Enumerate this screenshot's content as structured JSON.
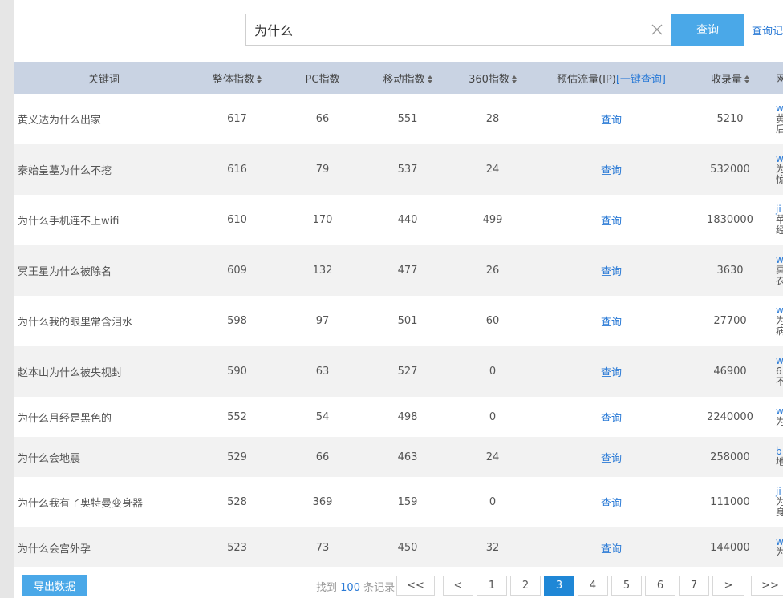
{
  "search": {
    "value": "为什么",
    "button": "查询",
    "history": "查询记"
  },
  "columns": {
    "keyword": "关键词",
    "overall": "整体指数",
    "pc": "PC指数",
    "mobile": "移动指数",
    "s360": "360指数",
    "traffic": "预估流量(IP)",
    "traffic_link": "[一键查询]",
    "indexed": "收录量",
    "site": "网"
  },
  "rows": [
    {
      "keyword": "黄义达为什么出家",
      "overall": "617",
      "pc": "66",
      "mobile": "551",
      "s360": "28",
      "traffic": "查询",
      "indexed": "5210",
      "site": [
        "w",
        "黄",
        "后"
      ]
    },
    {
      "keyword": "秦始皇墓为什么不挖",
      "overall": "616",
      "pc": "79",
      "mobile": "537",
      "s360": "24",
      "traffic": "查询",
      "indexed": "532000",
      "site": [
        "w",
        "为",
        "惊"
      ]
    },
    {
      "keyword": "为什么手机连不上wifi",
      "overall": "610",
      "pc": "170",
      "mobile": "440",
      "s360": "499",
      "traffic": "查询",
      "indexed": "1830000",
      "site": [
        "ji",
        "苹",
        "经"
      ]
    },
    {
      "keyword": "冥王星为什么被除名",
      "overall": "609",
      "pc": "132",
      "mobile": "477",
      "s360": "26",
      "traffic": "查询",
      "indexed": "3630",
      "site": [
        "w",
        "冥",
        "农"
      ]
    },
    {
      "keyword": "为什么我的眼里常含泪水",
      "overall": "598",
      "pc": "97",
      "mobile": "501",
      "s360": "60",
      "traffic": "查询",
      "indexed": "27700",
      "site": [
        "w",
        "为",
        "病"
      ]
    },
    {
      "keyword": "赵本山为什么被央视封",
      "overall": "590",
      "pc": "63",
      "mobile": "527",
      "s360": "0",
      "traffic": "查询",
      "indexed": "46900",
      "site": [
        "w",
        "6",
        "不"
      ]
    },
    {
      "keyword": "为什么月经是黑色的",
      "overall": "552",
      "pc": "54",
      "mobile": "498",
      "s360": "0",
      "traffic": "查询",
      "indexed": "2240000",
      "site": [
        "w",
        "为"
      ]
    },
    {
      "keyword": "为什么会地震",
      "overall": "529",
      "pc": "66",
      "mobile": "463",
      "s360": "24",
      "traffic": "查询",
      "indexed": "258000",
      "site": [
        "b",
        "地"
      ]
    },
    {
      "keyword": "为什么我有了奥特曼变身器",
      "overall": "528",
      "pc": "369",
      "mobile": "159",
      "s360": "0",
      "traffic": "查询",
      "indexed": "111000",
      "site": [
        "ji",
        "为",
        "身"
      ]
    },
    {
      "keyword": "为什么会宫外孕",
      "overall": "523",
      "pc": "73",
      "mobile": "450",
      "s360": "32",
      "traffic": "查询",
      "indexed": "144000",
      "site": [
        "w",
        "为"
      ]
    }
  ],
  "footer": {
    "export": "导出数据",
    "found_prefix": "找到",
    "found_count": "100",
    "found_suffix": "条记录",
    "pages": [
      "<<",
      "<",
      "1",
      "2",
      "3",
      "4",
      "5",
      "6",
      "7",
      ">",
      ">>"
    ],
    "active_page": "3"
  },
  "colors": {
    "accent": "#4aa8e8",
    "link": "#2a7ad6",
    "header_bg": "#c9d3e3",
    "active_page": "#1f87d6"
  }
}
